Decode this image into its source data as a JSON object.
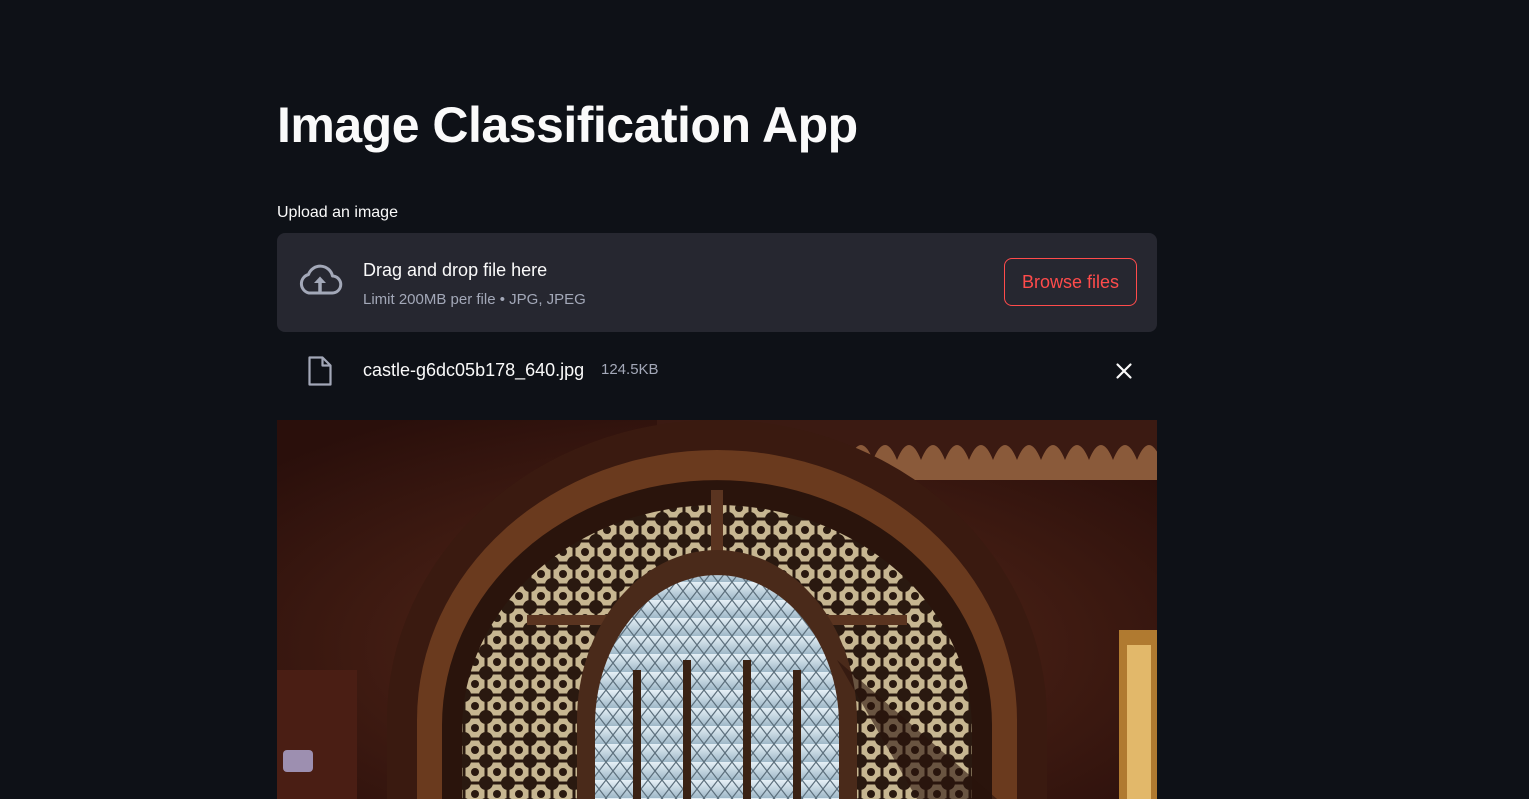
{
  "page": {
    "title": "Image Classification App"
  },
  "uploader": {
    "label": "Upload an image",
    "drop_text": "Drag and drop file here",
    "limit_text": "Limit 200MB per file • JPG, JPEG",
    "browse_label": "Browse files",
    "icon": "cloud-upload-icon"
  },
  "uploaded_file": {
    "name": "castle-g6dc05b178_640.jpg",
    "size": "124.5KB",
    "icon": "file-icon",
    "remove_icon": "close-icon"
  },
  "colors": {
    "background": "#0e1117",
    "dropzone": "#262730",
    "accent": "#ff4b4b",
    "text": "#fafafa",
    "muted": "#a3a8b8"
  }
}
